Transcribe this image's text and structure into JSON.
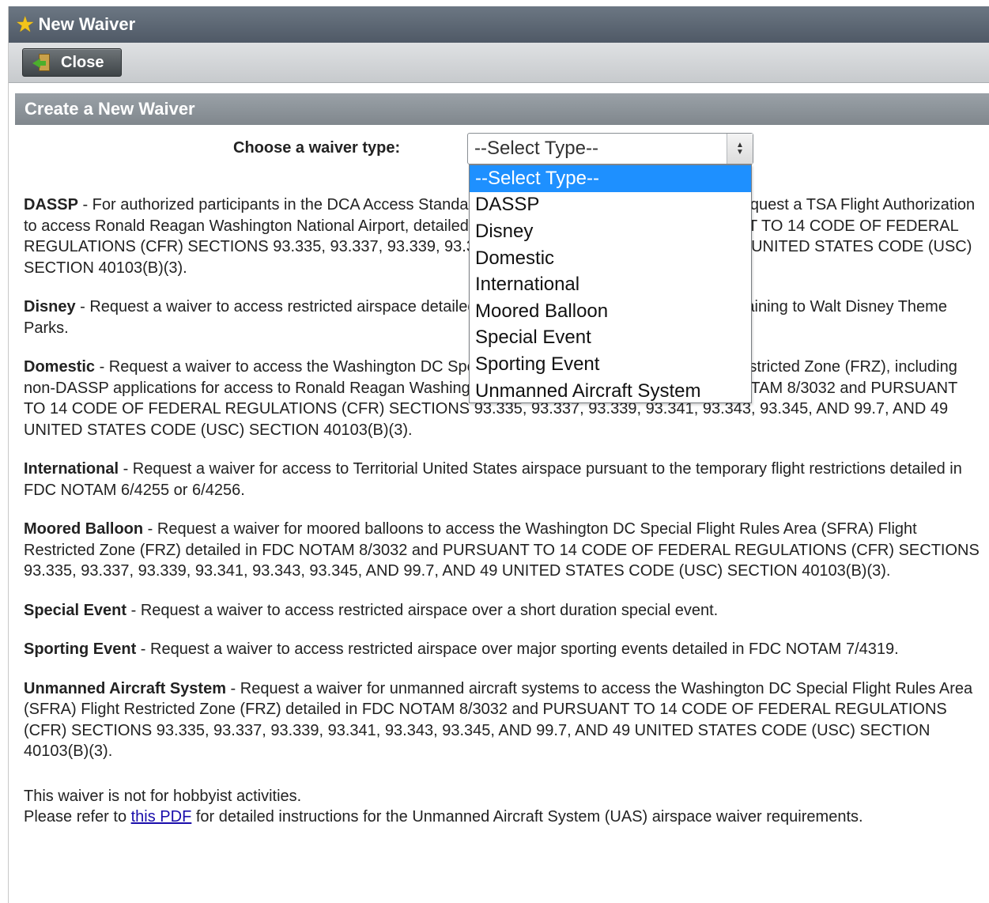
{
  "window": {
    "title": "New Waiver"
  },
  "toolbar": {
    "close_label": "Close"
  },
  "panel": {
    "title": "Create a New Waiver"
  },
  "chooser": {
    "label": "Choose a waiver type:",
    "selected_value": "--Select Type--",
    "options": [
      "--Select Type--",
      "DASSP",
      "Disney",
      "Domestic",
      "International",
      "Moored Balloon",
      "Special Event",
      "Sporting Event",
      "Unmanned Aircraft System"
    ]
  },
  "descriptions": [
    {
      "name": "DASSP",
      "text": " - For authorized participants in the DCA Access Standard Security Program (DASSP) only, to request a TSA Flight Authorization to access Ronald Reagan Washington National Airport, detailed in FDC NOTAM 8/3032 and PURSUANT TO 14 CODE OF FEDERAL REGULATIONS (CFR) SECTIONS 93.335, 93.337, 93.339, 93.341, 93.343, 93.345, AND 99.7, AND 49 UNITED STATES CODE (USC) SECTION 40103(B)(3)."
    },
    {
      "name": "Disney",
      "text": " - Request a waiver to access restricted airspace detailed in FDC NOTAM 4/3621 or 4/3635 pertaining to Walt Disney Theme Parks."
    },
    {
      "name": "Domestic",
      "text": " - Request a waiver to access the Washington DC Special Flight Rules Area (SFRA) Flight Restricted Zone (FRZ), including non-DASSP applications for access to Ronald Reagan Washington National Airport, detailed in FDC NOTAM 8/3032 and PURSUANT TO 14 CODE OF FEDERAL REGULATIONS (CFR) SECTIONS 93.335, 93.337, 93.339, 93.341, 93.343, 93.345, AND 99.7, AND 49 UNITED STATES CODE (USC) SECTION 40103(B)(3)."
    },
    {
      "name": "International",
      "text": " - Request a waiver for access to Territorial United States airspace pursuant to the temporary flight restrictions detailed in FDC NOTAM 6/4255 or 6/4256."
    },
    {
      "name": "Moored Balloon",
      "text": " - Request a waiver for moored balloons to access the Washington DC Special Flight Rules Area (SFRA) Flight Restricted Zone (FRZ) detailed in FDC NOTAM 8/3032 and PURSUANT TO 14 CODE OF FEDERAL REGULATIONS (CFR) SECTIONS 93.335, 93.337, 93.339, 93.341, 93.343, 93.345, AND 99.7, AND 49 UNITED STATES CODE (USC) SECTION 40103(B)(3)."
    },
    {
      "name": "Special Event",
      "text": " - Request a waiver to access restricted airspace over a short duration special event."
    },
    {
      "name": "Sporting Event",
      "text": " - Request a waiver to access restricted airspace over major sporting events detailed in FDC NOTAM 7/4319."
    },
    {
      "name": "Unmanned Aircraft System",
      "text": " - Request a waiver for unmanned aircraft systems to access the Washington DC Special Flight Rules Area (SFRA) Flight Restricted Zone (FRZ) detailed in FDC NOTAM 8/3032 and PURSUANT TO 14 CODE OF FEDERAL REGULATIONS (CFR) SECTIONS 93.335, 93.337, 93.339, 93.341, 93.343, 93.345, AND 99.7, AND 49 UNITED STATES CODE (USC) SECTION 40103(B)(3)."
    }
  ],
  "footer": {
    "line1": "This waiver is not for hobbyist activities.",
    "line2_prefix": "Please refer to ",
    "link_text": "this PDF",
    "line2_suffix": " for detailed instructions for the Unmanned Aircraft System (UAS) airspace waiver requirements."
  },
  "icons": {
    "title": "star-icon",
    "close": "exit-door-icon",
    "select": "select-arrows-icon"
  },
  "colors": {
    "titlebar": "#5a6470",
    "panel_header": "#8c9399",
    "selected_option": "#1e90ff",
    "link": "#1a0dab"
  }
}
